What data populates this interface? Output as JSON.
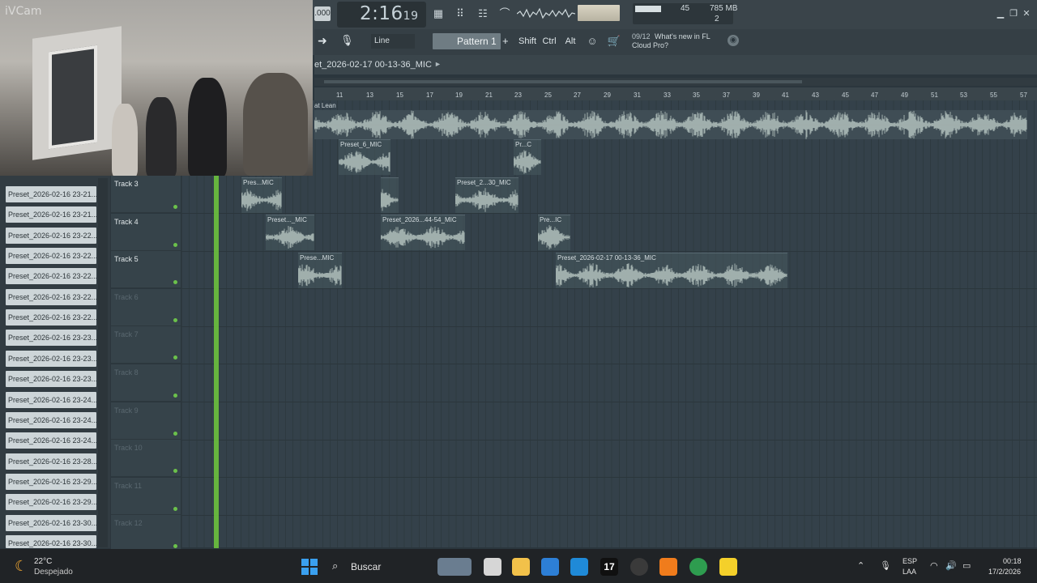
{
  "window": {
    "tempo": ".000",
    "time_main": "2:16",
    "time_sub": "19",
    "cpu": "45",
    "memory": "785 MB",
    "polyphony": "2"
  },
  "toolbar": {
    "snap_mode": "Line",
    "pattern": "Pattern 1",
    "modifiers": [
      "Shift",
      "Ctrl",
      "Alt"
    ],
    "news_date": "09/12",
    "news_line1": "What's new in FL",
    "news_line2": "Cloud Pro?"
  },
  "webcam": {
    "label": "iVCam"
  },
  "playlist": {
    "title": "et_2026-02-17 00-13-36_MIC",
    "master_label": "at Lean",
    "ruler": [
      "11",
      "13",
      "15",
      "17",
      "19",
      "21",
      "23",
      "25",
      "27",
      "29",
      "31",
      "33",
      "35",
      "37",
      "39",
      "41",
      "43",
      "45",
      "47",
      "49",
      "51",
      "53",
      "55",
      "57"
    ]
  },
  "browser": {
    "items": [
      "Preset_2026-02-16 23-21...",
      "Preset_2026-02-16 23-21...",
      "Preset_2026-02-16 23-22...",
      "Preset_2026-02-16 23-22...",
      "Preset_2026-02-16 23-22...",
      "Preset_2026-02-16 23-22...",
      "Preset_2026-02-16 23-22...",
      "Preset_2026-02-16 23-23...",
      "Preset_2026-02-16 23-23...",
      "Preset_2026-02-16 23-23...",
      "Preset_2026-02-16 23-24...",
      "Preset_2026-02-16 23-24...",
      "Preset_2026-02-16 23-24...",
      "Preset_2026-02-16 23-28...",
      "Preset_2026-02-16 23-29...",
      "Preset_2026-02-16 23-29...",
      "Preset_2026-02-16 23-30...",
      "Preset_2026-02-16 23-30..."
    ]
  },
  "tracks": [
    {
      "name": "Track 3",
      "dim": false
    },
    {
      "name": "Track 4",
      "dim": false
    },
    {
      "name": "Track 5",
      "dim": false
    },
    {
      "name": "Track 6",
      "dim": true
    },
    {
      "name": "Track 7",
      "dim": true
    },
    {
      "name": "Track 8",
      "dim": true
    },
    {
      "name": "Track 9",
      "dim": true
    },
    {
      "name": "Track 10",
      "dim": true
    },
    {
      "name": "Track 11",
      "dim": true
    },
    {
      "name": "Track 12",
      "dim": true
    }
  ],
  "clips": [
    {
      "title": "Preset_6_MIC"
    },
    {
      "title": "Pr...C"
    },
    {
      "title": "Pres...MIC"
    },
    {
      "title": ""
    },
    {
      "title": "Preset_2...30_MIC"
    },
    {
      "title": "Preset..._MIC"
    },
    {
      "title": "Preset_2026...44-54_MIC"
    },
    {
      "title": "Pre...IC"
    },
    {
      "title": "Prese...MIC"
    },
    {
      "title": "Preset_2026-02-17 00-13-36_MIC"
    }
  ],
  "taskbar": {
    "weather_temp": "22°C",
    "weather_desc": "Despejado",
    "search": "Buscar",
    "lang1": "ESP",
    "lang2": "LAA",
    "time": "00:18",
    "date": "17/2/2026"
  },
  "colors": {
    "accent_green": "#6cc13d",
    "clip_wave": "#b9c8c3"
  }
}
